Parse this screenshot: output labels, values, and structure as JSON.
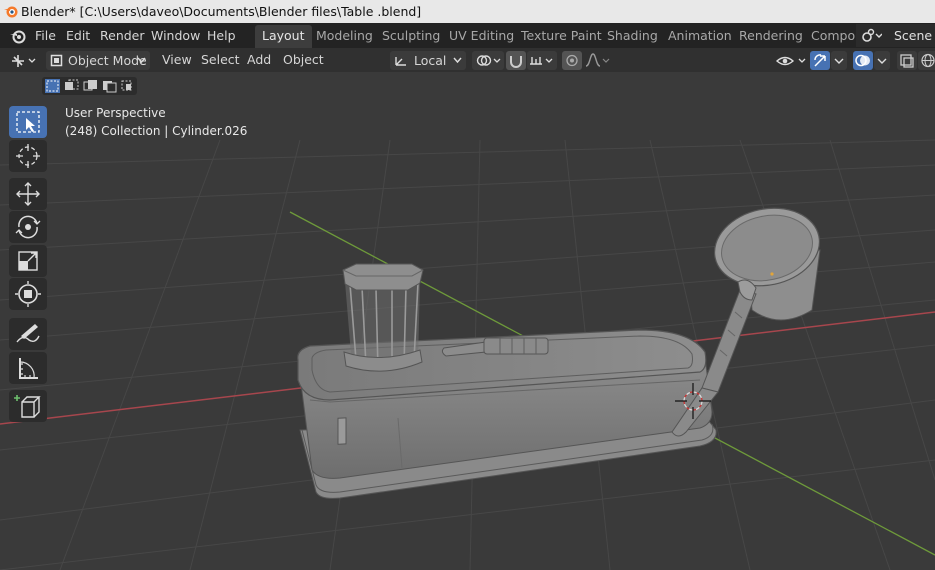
{
  "window": {
    "title": "Blender* [C:\\Users\\daveo\\Documents\\Blender files\\Table .blend]"
  },
  "menu": [
    "File",
    "Edit",
    "Render",
    "Window",
    "Help"
  ],
  "workspaces": [
    "Layout",
    "Modeling",
    "Sculpting",
    "UV Editing",
    "Texture Paint",
    "Shading",
    "Animation",
    "Rendering",
    "Compo"
  ],
  "active_workspace": "Layout",
  "scene": "Scene",
  "header": {
    "mode": "Object Mode",
    "menus": [
      "View",
      "Select",
      "Add",
      "Object"
    ],
    "orientation": "Local"
  },
  "viewport": {
    "perspective": "User Perspective",
    "info": "(248) Collection | Cylinder.026"
  },
  "toolbar": {
    "tools": [
      "select-box-tool",
      "cursor-tool",
      "move-tool",
      "rotate-tool",
      "scale-tool",
      "transform-tool",
      "annotate-tool",
      "measure-tool",
      "add-cube-tool"
    ],
    "active": "select-box-tool"
  },
  "colors": {
    "accent": "#4772b3",
    "viewport_bg": "#3a3a3a",
    "axis_x": "#a7464d",
    "axis_y": "#6e9a3a"
  }
}
